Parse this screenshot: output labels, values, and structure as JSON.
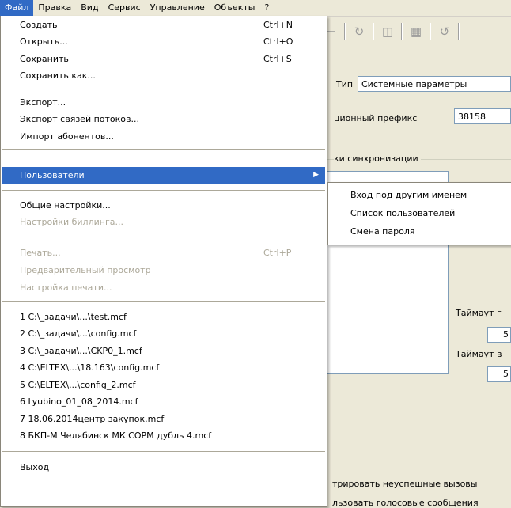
{
  "menubar": {
    "items": [
      "Файл",
      "Правка",
      "Вид",
      "Сервис",
      "Управление",
      "Объекты",
      "?"
    ]
  },
  "background": {
    "type_label": "Тип",
    "type_value": "Системные параметры",
    "prefix_label": "ционный префикс",
    "prefix_value": "38158",
    "sync_label": "ки синхронизации",
    "timeout1_label": "Таймаут г",
    "timeout1_value": "5",
    "timeout2_label": "Таймаут в",
    "timeout2_value": "5",
    "checkbox1_label": "трировать неуспешные вызовы",
    "checkbox2_label": "льзовать голосовые сообщения"
  },
  "file_menu": {
    "create": {
      "label": "Создать",
      "shortcut": "Ctrl+N"
    },
    "open": {
      "label": "Открыть...",
      "shortcut": "Ctrl+O"
    },
    "save": {
      "label": "Сохранить",
      "shortcut": "Ctrl+S"
    },
    "save_as": {
      "label": "Сохранить как..."
    },
    "export": {
      "label": "Экспорт..."
    },
    "export_links": {
      "label": "Экспорт связей потоков..."
    },
    "import_subscribers": {
      "label": "Импорт абонентов..."
    },
    "users": {
      "label": "Пользователи"
    },
    "general_settings": {
      "label": "Общие настройки..."
    },
    "billing_settings": {
      "label": "Настройки биллинга..."
    },
    "print": {
      "label": "Печать...",
      "shortcut": "Ctrl+P"
    },
    "preview": {
      "label": "Предварительный просмотр"
    },
    "print_setup": {
      "label": "Настройка печати..."
    },
    "recent": [
      "1 C:\\_задачи\\...\\test.mcf",
      "2 C:\\_задачи\\...\\config.mcf",
      "3 C:\\_задачи\\...\\CKP0_1.mcf",
      "4 C:\\ELTEX\\...\\18.163\\config.mcf",
      "5 C:\\ELTEX\\...\\config_2.mcf",
      "6 Lyubino_01_08_2014.mcf",
      "7 18.06.2014центр закупок.mcf",
      "8 БКП-М Челябинск МК СОРМ дубль 4.mcf"
    ],
    "exit": {
      "label": "Выход"
    }
  },
  "users_submenu": {
    "items": [
      "Вход под другим именем",
      "Список пользователей",
      "Смена пароля"
    ]
  },
  "colors": {
    "highlight": "#316ac5",
    "menu_bg": "#ffffff",
    "window_bg": "#ece9d8",
    "disabled_text": "#aca899"
  }
}
